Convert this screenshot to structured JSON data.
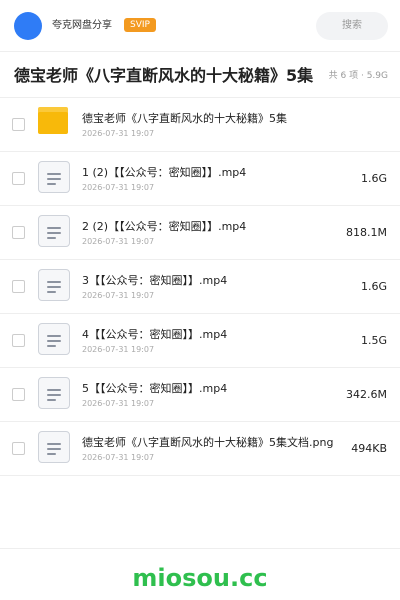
{
  "header": {
    "user_name": "夸克网盘分享",
    "badge": "SVIP",
    "search_label": "搜索",
    "accent_color": "#2f7cf6",
    "badge_color": "#f39a20"
  },
  "share": {
    "title": "德宝老师《八字直断风水的十大秘籍》5集",
    "meta": "共 6 项 · 5.9G"
  },
  "files": [
    {
      "name": "德宝老师《八字直断风水的十大秘籍》5集",
      "date": "2026-07-31 19:07",
      "size": "",
      "icon": "folder-icon"
    },
    {
      "name": "1 (2)【【公众号：密知圈】】.mp4",
      "date": "2026-07-31 19:07",
      "size": "1.6G",
      "icon": "file-icon"
    },
    {
      "name": "2 (2)【【公众号：密知圈】】.mp4",
      "date": "2026-07-31 19:07",
      "size": "818.1M",
      "icon": "file-icon"
    },
    {
      "name": "3【【公众号：密知圈】】.mp4",
      "date": "2026-07-31 19:07",
      "size": "1.6G",
      "icon": "file-icon"
    },
    {
      "name": "4【【公众号：密知圈】】.mp4",
      "date": "2026-07-31 19:07",
      "size": "1.5G",
      "icon": "file-icon"
    },
    {
      "name": "5【【公众号：密知圈】】.mp4",
      "date": "2026-07-31 19:07",
      "size": "342.6M",
      "icon": "file-icon"
    },
    {
      "name": "德宝老师《八字直断风水的十大秘籍》5集文档.png",
      "date": "2026-07-31 19:07",
      "size": "494KB",
      "icon": "file-icon"
    }
  ],
  "footer": {
    "watermark": "miosou.cc",
    "watermark_color": "#2fbf4e"
  }
}
